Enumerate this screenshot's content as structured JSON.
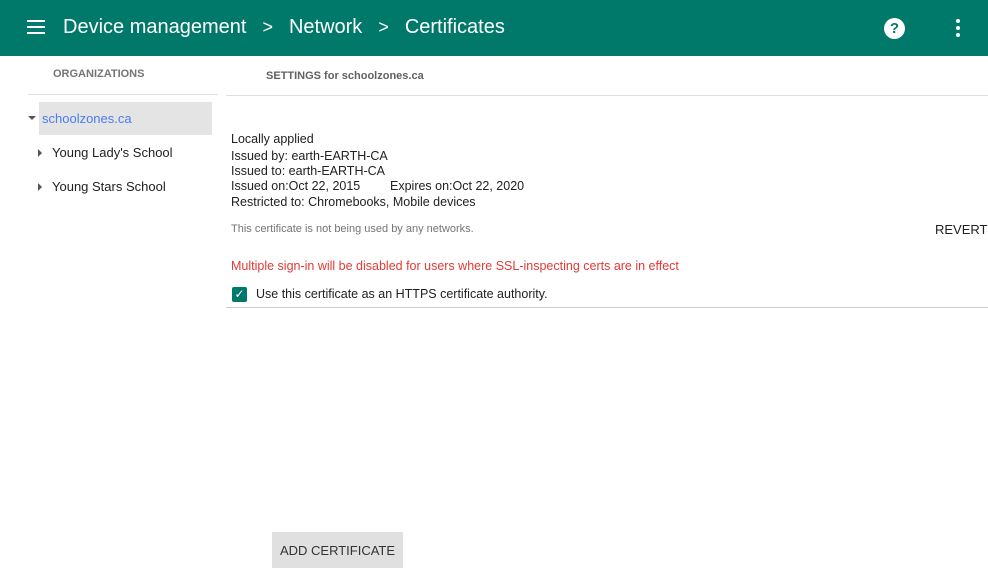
{
  "header": {
    "crumbs": [
      "Device management",
      "Network",
      "Certificates"
    ],
    "separator": ">"
  },
  "sidebar": {
    "title": "ORGANIZATIONS",
    "root": "schoolzones.ca",
    "children": [
      "Young Lady's School",
      "Young Stars School"
    ]
  },
  "main": {
    "title": "SETTINGS for schoolzones.ca",
    "locally_applied": "Locally applied",
    "issued_by": "Issued by: earth-EARTH-CA",
    "issued_to": "Issued to: earth-EARTH-CA",
    "issued_on": "Issued on:Oct 22, 2015",
    "expires_on": "Expires on:Oct 22, 2020",
    "restricted": "Restricted to: Chromebooks, Mobile devices",
    "usage": "This certificate is not being used by any networks.",
    "revert": "REVERT",
    "warning": "Multiple sign-in will be disabled for users where SSL-inspecting certs are in effect",
    "checkbox_label": "Use this certificate as an HTTPS certificate authority.",
    "checkbox_checked": true,
    "add_button": "ADD CERTIFICATE"
  },
  "colors": {
    "brand": "#00796b",
    "warning": "#e53935",
    "link": "#4a7cf2"
  }
}
